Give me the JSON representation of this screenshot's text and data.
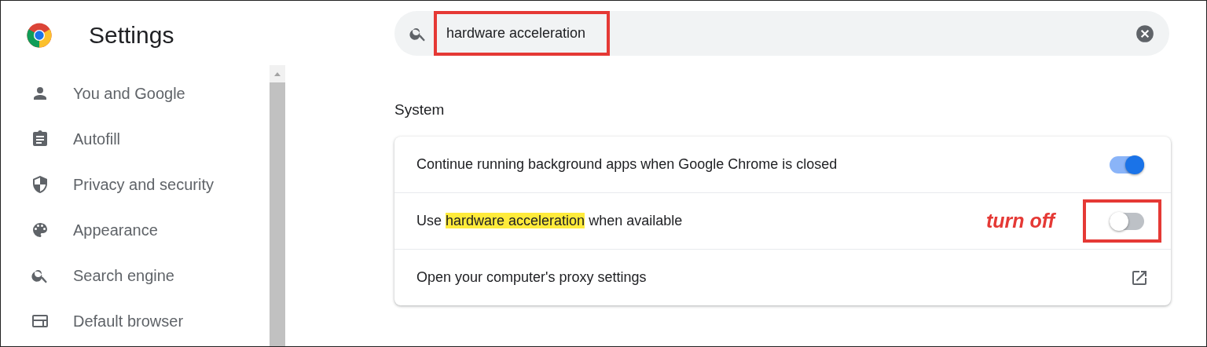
{
  "header": {
    "title": "Settings"
  },
  "sidebar": {
    "items": [
      {
        "label": "You and Google",
        "selected": false
      },
      {
        "label": "Autofill",
        "selected": false
      },
      {
        "label": "Privacy and security",
        "selected": false
      },
      {
        "label": "Appearance",
        "selected": false
      },
      {
        "label": "Search engine",
        "selected": false
      },
      {
        "label": "Default browser",
        "selected": false
      }
    ]
  },
  "search": {
    "value": "hardware acceleration",
    "outlined": true
  },
  "section": {
    "title": "System",
    "rows": [
      {
        "kind": "toggle",
        "label": {
          "before": "Continue running background apps when Google Chrome is closed"
        },
        "on": true,
        "outlined": false
      },
      {
        "kind": "toggle",
        "label": {
          "before": "Use",
          "highlight": "hardware acceleration",
          "after": "when available"
        },
        "on": false,
        "outlined": true,
        "annotation": "turn off"
      },
      {
        "kind": "link",
        "label": {
          "before": "Open your computer's proxy settings"
        }
      }
    ]
  }
}
